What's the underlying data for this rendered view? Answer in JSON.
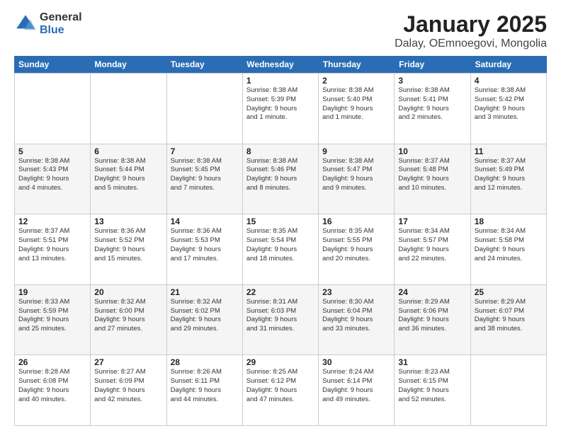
{
  "logo": {
    "general": "General",
    "blue": "Blue"
  },
  "header": {
    "title": "January 2025",
    "subtitle": "Dalay, OEmnoegovi, Mongolia"
  },
  "weekdays": [
    "Sunday",
    "Monday",
    "Tuesday",
    "Wednesday",
    "Thursday",
    "Friday",
    "Saturday"
  ],
  "weeks": [
    [
      {
        "day": "",
        "info": ""
      },
      {
        "day": "",
        "info": ""
      },
      {
        "day": "",
        "info": ""
      },
      {
        "day": "1",
        "info": "Sunrise: 8:38 AM\nSunset: 5:39 PM\nDaylight: 9 hours\nand 1 minute."
      },
      {
        "day": "2",
        "info": "Sunrise: 8:38 AM\nSunset: 5:40 PM\nDaylight: 9 hours\nand 1 minute."
      },
      {
        "day": "3",
        "info": "Sunrise: 8:38 AM\nSunset: 5:41 PM\nDaylight: 9 hours\nand 2 minutes."
      },
      {
        "day": "4",
        "info": "Sunrise: 8:38 AM\nSunset: 5:42 PM\nDaylight: 9 hours\nand 3 minutes."
      }
    ],
    [
      {
        "day": "5",
        "info": "Sunrise: 8:38 AM\nSunset: 5:43 PM\nDaylight: 9 hours\nand 4 minutes."
      },
      {
        "day": "6",
        "info": "Sunrise: 8:38 AM\nSunset: 5:44 PM\nDaylight: 9 hours\nand 5 minutes."
      },
      {
        "day": "7",
        "info": "Sunrise: 8:38 AM\nSunset: 5:45 PM\nDaylight: 9 hours\nand 7 minutes."
      },
      {
        "day": "8",
        "info": "Sunrise: 8:38 AM\nSunset: 5:46 PM\nDaylight: 9 hours\nand 8 minutes."
      },
      {
        "day": "9",
        "info": "Sunrise: 8:38 AM\nSunset: 5:47 PM\nDaylight: 9 hours\nand 9 minutes."
      },
      {
        "day": "10",
        "info": "Sunrise: 8:37 AM\nSunset: 5:48 PM\nDaylight: 9 hours\nand 10 minutes."
      },
      {
        "day": "11",
        "info": "Sunrise: 8:37 AM\nSunset: 5:49 PM\nDaylight: 9 hours\nand 12 minutes."
      }
    ],
    [
      {
        "day": "12",
        "info": "Sunrise: 8:37 AM\nSunset: 5:51 PM\nDaylight: 9 hours\nand 13 minutes."
      },
      {
        "day": "13",
        "info": "Sunrise: 8:36 AM\nSunset: 5:52 PM\nDaylight: 9 hours\nand 15 minutes."
      },
      {
        "day": "14",
        "info": "Sunrise: 8:36 AM\nSunset: 5:53 PM\nDaylight: 9 hours\nand 17 minutes."
      },
      {
        "day": "15",
        "info": "Sunrise: 8:35 AM\nSunset: 5:54 PM\nDaylight: 9 hours\nand 18 minutes."
      },
      {
        "day": "16",
        "info": "Sunrise: 8:35 AM\nSunset: 5:55 PM\nDaylight: 9 hours\nand 20 minutes."
      },
      {
        "day": "17",
        "info": "Sunrise: 8:34 AM\nSunset: 5:57 PM\nDaylight: 9 hours\nand 22 minutes."
      },
      {
        "day": "18",
        "info": "Sunrise: 8:34 AM\nSunset: 5:58 PM\nDaylight: 9 hours\nand 24 minutes."
      }
    ],
    [
      {
        "day": "19",
        "info": "Sunrise: 8:33 AM\nSunset: 5:59 PM\nDaylight: 9 hours\nand 25 minutes."
      },
      {
        "day": "20",
        "info": "Sunrise: 8:32 AM\nSunset: 6:00 PM\nDaylight: 9 hours\nand 27 minutes."
      },
      {
        "day": "21",
        "info": "Sunrise: 8:32 AM\nSunset: 6:02 PM\nDaylight: 9 hours\nand 29 minutes."
      },
      {
        "day": "22",
        "info": "Sunrise: 8:31 AM\nSunset: 6:03 PM\nDaylight: 9 hours\nand 31 minutes."
      },
      {
        "day": "23",
        "info": "Sunrise: 8:30 AM\nSunset: 6:04 PM\nDaylight: 9 hours\nand 33 minutes."
      },
      {
        "day": "24",
        "info": "Sunrise: 8:29 AM\nSunset: 6:06 PM\nDaylight: 9 hours\nand 36 minutes."
      },
      {
        "day": "25",
        "info": "Sunrise: 8:29 AM\nSunset: 6:07 PM\nDaylight: 9 hours\nand 38 minutes."
      }
    ],
    [
      {
        "day": "26",
        "info": "Sunrise: 8:28 AM\nSunset: 6:08 PM\nDaylight: 9 hours\nand 40 minutes."
      },
      {
        "day": "27",
        "info": "Sunrise: 8:27 AM\nSunset: 6:09 PM\nDaylight: 9 hours\nand 42 minutes."
      },
      {
        "day": "28",
        "info": "Sunrise: 8:26 AM\nSunset: 6:11 PM\nDaylight: 9 hours\nand 44 minutes."
      },
      {
        "day": "29",
        "info": "Sunrise: 8:25 AM\nSunset: 6:12 PM\nDaylight: 9 hours\nand 47 minutes."
      },
      {
        "day": "30",
        "info": "Sunrise: 8:24 AM\nSunset: 6:14 PM\nDaylight: 9 hours\nand 49 minutes."
      },
      {
        "day": "31",
        "info": "Sunrise: 8:23 AM\nSunset: 6:15 PM\nDaylight: 9 hours\nand 52 minutes."
      },
      {
        "day": "",
        "info": ""
      }
    ]
  ]
}
